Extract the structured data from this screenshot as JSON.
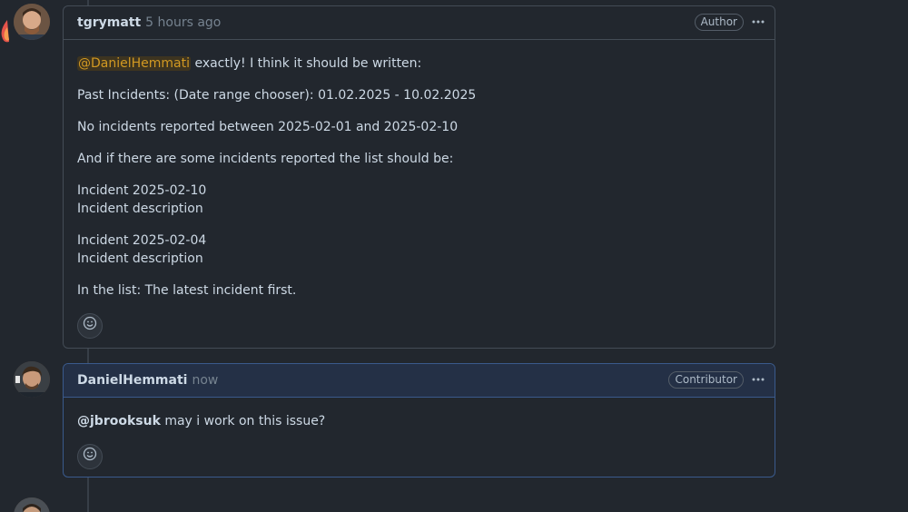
{
  "comments": [
    {
      "author": "tgrymatt",
      "time": "5 hours ago",
      "badge": "Author",
      "mention": "@DanielHemmati",
      "first_line_rest": " exactly! I think it should be written:",
      "para2": "Past Incidents: (Date range chooser): 01.02.2025 - 10.02.2025",
      "para3": "No incidents reported between 2025-02-01 and 2025-02-10",
      "para4": "And if there are some incidents reported the list should be:",
      "inc1_title": "Incident 2025-02-10",
      "inc1_desc": "Incident description",
      "inc2_title": "Incident 2025-02-04",
      "inc2_desc": "Incident description",
      "para7": "In the list: The latest incident first."
    },
    {
      "author": "DanielHemmati",
      "time": "now",
      "badge": "Contributor",
      "mention": "@jbrooksuk",
      "text_rest": " may i work on this issue?"
    }
  ],
  "icons": {
    "kebab": "kebab-horizontal-icon",
    "reaction": "smiley-icon"
  },
  "colors": {
    "background": "#22272e",
    "border": "#444c56",
    "self_border": "#3a5a8c",
    "mention_highlight": "#d29922"
  }
}
